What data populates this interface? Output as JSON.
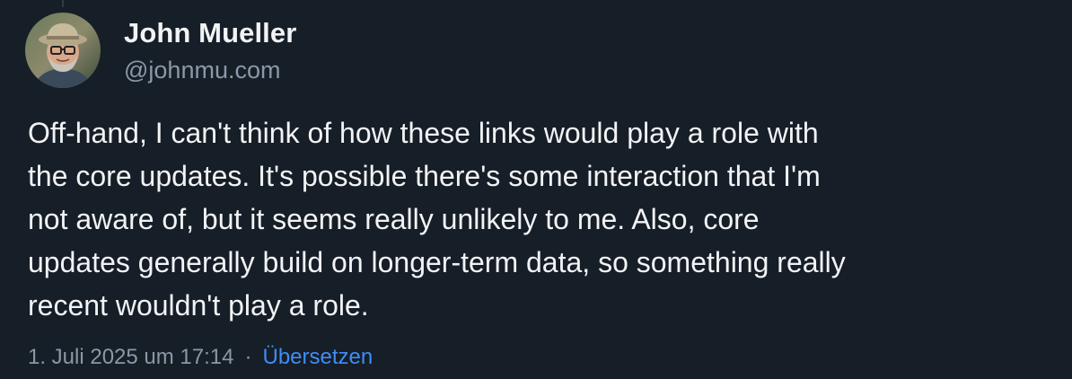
{
  "author": {
    "display_name": "John Mueller",
    "handle": "@johnmu.com"
  },
  "post": {
    "lines": [
      "Off-hand, I can't think of how these links would play a role with",
      "the core updates. It's possible there's some interaction that I'm",
      "not aware of, but it seems really unlikely to me. Also, core",
      "updates generally build on longer-term data, so something really",
      "recent wouldn't play a role."
    ]
  },
  "meta": {
    "timestamp": "1. Juli 2025 um 17:14",
    "separator": "·",
    "translate_label": "Übersetzen"
  },
  "colors": {
    "background": "#161e27",
    "text_primary": "#f1f3f5",
    "text_secondary": "#8a98a8",
    "link": "#3f8df5"
  }
}
